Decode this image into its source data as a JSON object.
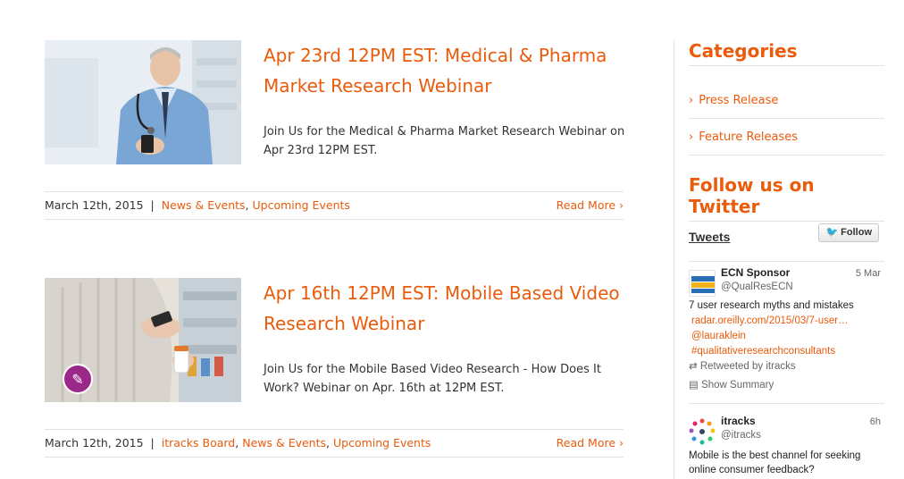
{
  "posts": [
    {
      "title": "Apr 23rd 12PM EST: Medical & Pharma Market Research Webinar",
      "excerpt": "Join Us for the Medical & Pharma Market Research Webinar on Apr 23rd 12PM EST.",
      "date": "March 12th, 2015",
      "categories": [
        "News & Events",
        "Upcoming Events"
      ],
      "read_more": "Read More ›"
    },
    {
      "title": "Apr 16th 12PM EST: Mobile Based Video Research Webinar",
      "excerpt": "Join Us for the Mobile Based Video Research - How Does It Work? Webinar on Apr. 16th at 12PM EST.",
      "date": "March 12th, 2015",
      "categories": [
        "itracks Board",
        "News & Events",
        "Upcoming Events"
      ],
      "read_more": "Read More ›"
    }
  ],
  "meta_separator": "|",
  "category_comma": ",",
  "sidebar": {
    "categories_title": "Categories",
    "categories": [
      {
        "label": "Press Release"
      },
      {
        "label": "Feature Releases"
      }
    ],
    "twitter_title": "Follow us on Twitter",
    "chevron": "›"
  },
  "twitter": {
    "tweets_label": "Tweets",
    "follow_label": "Follow",
    "tweets": [
      {
        "name": "ECN Sponsor",
        "handle": "@QualResECN",
        "time": "5 Mar",
        "text": "7 user research myths and mistakes",
        "links": [
          "radar.oreilly.com/2015/03/7-user…",
          "@lauraklein",
          "#qualitativeresearchconsultants"
        ],
        "retweeted": "Retweeted by itracks",
        "summary": "Show Summary"
      },
      {
        "name": "itracks",
        "handle": "@itracks",
        "time": "6h",
        "text": "Mobile is the best channel for seeking online consumer feedback?"
      }
    ]
  },
  "colors": {
    "accent": "#ea5b0c",
    "pin": "#9b2889",
    "twitter_blue": "#2fa3e6"
  }
}
